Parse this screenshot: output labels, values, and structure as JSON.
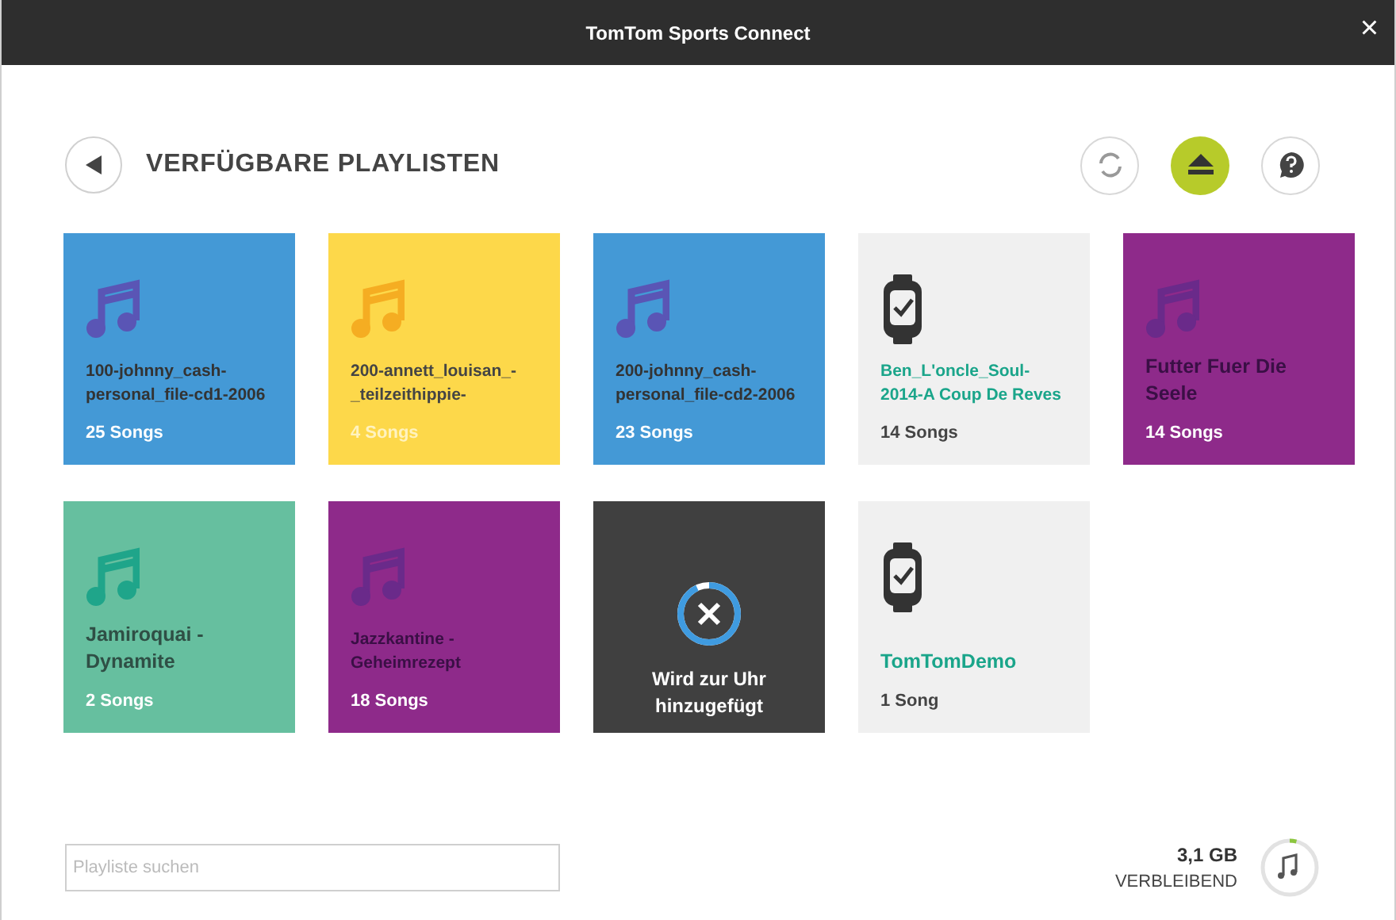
{
  "window": {
    "title": "TomTom Sports Connect",
    "close": "×"
  },
  "heading": "VERFÜGBARE PLAYLISTEN",
  "playlists": [
    {
      "kind": "playlist",
      "color": "#4499d6",
      "name": "100-johnny_cash-personal_file-cd1-2006",
      "count": "25 Songs"
    },
    {
      "kind": "playlist",
      "color": "#fdd84a",
      "name": "200-annett_louisan_-_teilzeithippie-",
      "count": "4 Songs"
    },
    {
      "kind": "playlist",
      "color": "#4499d6",
      "name": "200-johnny_cash-personal_file-cd2-2006",
      "count": "23 Songs"
    },
    {
      "kind": "on_watch",
      "color": "#f0f0f0",
      "name": "Ben_L'oncle_Soul-2014-A Coup De Reves",
      "count": "14 Songs"
    },
    {
      "kind": "playlist",
      "color": "#8e2a8a",
      "name": "Futter Fuer Die Seele",
      "count": "14 Songs"
    },
    {
      "kind": "playlist",
      "color": "#66bf9f",
      "name": "Jamiroquai - Dynamite",
      "count": "2 Songs"
    },
    {
      "kind": "playlist",
      "color": "#8e2a8a",
      "name": "Jazzkantine - Geheimrezept",
      "count": "18 Songs"
    },
    {
      "kind": "adding",
      "color": "#404040",
      "status": "Wird zur Uhr hinzugefügt",
      "level": 0.93
    },
    {
      "kind": "on_watch",
      "color": "#f0f0f0",
      "name": "TomTomDemo",
      "count": "1 Song"
    }
  ],
  "search": {
    "placeholder": "Playliste suchen"
  },
  "storage": {
    "amount": "3,1 GB",
    "label": "VERBLEIBEND",
    "level": 0.04
  }
}
